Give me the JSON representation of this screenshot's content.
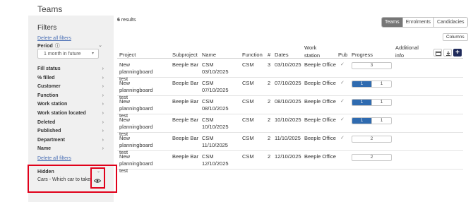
{
  "page": {
    "title": "Teams"
  },
  "sidebar": {
    "filters_title": "Filters",
    "delete_all_top": "Delete all filters",
    "period_label": "Period",
    "period_value": "1 month in future",
    "filter_items": [
      "Fill status",
      "% filled",
      "Customer",
      "Function",
      "Work station",
      "Work station located",
      "Deleted",
      "Published",
      "Department",
      "Name"
    ],
    "delete_all_bottom": "Delete all filters",
    "hidden_label": "Hidden",
    "hidden_value": "Cars - Which car to take"
  },
  "toolbar": {
    "results_count": "6",
    "results_text": " results",
    "tabs": [
      "Teams",
      "Enrolments",
      "Candidacies"
    ],
    "active_tab": "Teams",
    "columns_label": "Columns"
  },
  "table": {
    "headers": {
      "project": "Project",
      "subproject": "Subproject",
      "name": "Name",
      "function": "Function",
      "number": "#",
      "dates": "Dates",
      "workstation": "Work station",
      "pub": "Pub",
      "progress": "Progress",
      "additional": "Additional info"
    },
    "rows": [
      {
        "project": "New planningboard test",
        "subproject": "Beeple Bar",
        "name": "CSM 03/10/2025",
        "function": "CSM",
        "count": "3",
        "date": "03/10/2025",
        "workstation": "Beeple Office",
        "pub": "✓",
        "progress": {
          "filled": 0,
          "total": 3,
          "labels": [
            "3"
          ]
        }
      },
      {
        "project": "New planningboard test",
        "subproject": "Beeple Bar",
        "name": "CSM 07/10/2025",
        "function": "CSM",
        "count": "2",
        "date": "07/10/2025",
        "workstation": "Beeple Office",
        "pub": "✓",
        "progress": {
          "filled": 1,
          "total": 2,
          "labels": [
            "1",
            "1"
          ]
        }
      },
      {
        "project": "New planningboard test",
        "subproject": "Beeple Bar",
        "name": "CSM 08/10/2025",
        "function": "CSM",
        "count": "2",
        "date": "08/10/2025",
        "workstation": "Beeple Office",
        "pub": "✓",
        "progress": {
          "filled": 1,
          "total": 2,
          "labels": [
            "1",
            "1"
          ]
        }
      },
      {
        "project": "New planningboard test",
        "subproject": "Beeple Bar",
        "name": "CSM 10/10/2025",
        "function": "CSM",
        "count": "2",
        "date": "10/10/2025",
        "workstation": "Beeple Office",
        "pub": "✓",
        "progress": {
          "filled": 1,
          "total": 2,
          "labels": [
            "1",
            "1"
          ]
        }
      },
      {
        "project": "New planningboard test",
        "subproject": "Beeple Bar",
        "name": "CSM 11/10/2025",
        "function": "CSM",
        "count": "2",
        "date": "11/10/2025",
        "workstation": "Beeple Office",
        "pub": "✓",
        "progress": {
          "filled": 0,
          "total": 2,
          "labels": [
            "2"
          ]
        }
      },
      {
        "project": "New planningboard test",
        "subproject": "Beeple Bar",
        "name": "CSM 12/10/2025",
        "function": "CSM",
        "count": "2",
        "date": "12/10/2025",
        "workstation": "Beeple Office",
        "pub": "",
        "progress": {
          "filled": 0,
          "total": 2,
          "labels": [
            "2"
          ]
        }
      }
    ]
  },
  "colors": {
    "accent": "#2f6bb0",
    "highlight": "#e0001a",
    "dark_button": "#1f2a5a"
  },
  "icons": [
    "info-icon",
    "chevron-down-icon",
    "chevron-right-icon",
    "eye-icon",
    "calendar-icon",
    "download-icon",
    "plus-icon",
    "check-icon"
  ]
}
